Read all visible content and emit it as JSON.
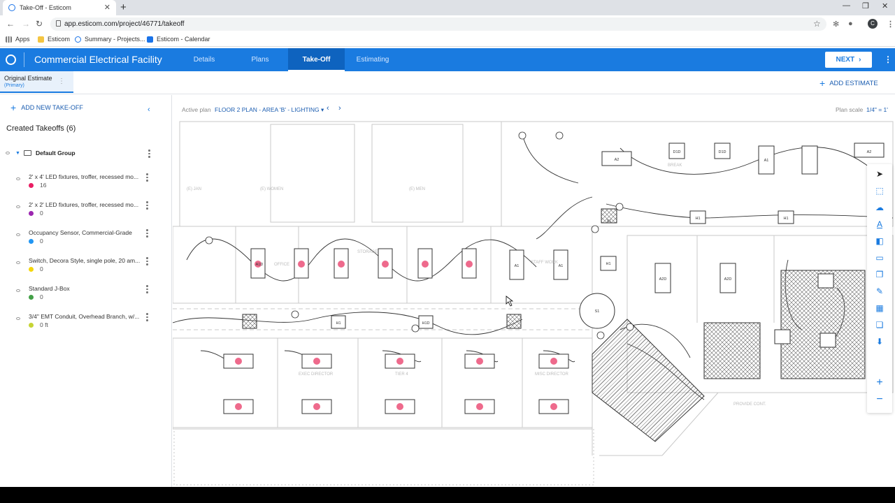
{
  "browser": {
    "tab_title": "Take-Off - Esticom",
    "url": "app.esticom.com/project/46771/takeoff",
    "avatar_initial": "C",
    "bookmarks": [
      "Apps",
      "Esticom",
      "Summary - Projects...",
      "Esticom - Calendar"
    ]
  },
  "app": {
    "project_title": "Commercial Electrical Facility",
    "tabs": [
      "Details",
      "Plans",
      "Take-Off",
      "Estimating"
    ],
    "active_tab": "Take-Off",
    "next_label": "NEXT",
    "accent_color": "#1a7be0"
  },
  "estimate": {
    "name": "Original Estimate",
    "sub": "(Primary)",
    "add_label": "ADD ESTIMATE"
  },
  "sidebar": {
    "add_label": "ADD NEW TAKE-OFF",
    "created_label": "Created Takeoffs (6)",
    "group_name": "Default Group",
    "items": [
      {
        "name": "2' x 4' LED fixtures, troffer, recessed mo...",
        "count": "16",
        "color": "#e91e63"
      },
      {
        "name": "2' x 2' LED fixtures, troffer, recessed mo...",
        "count": "0",
        "color": "#9c27b0"
      },
      {
        "name": "Occupancy Sensor, Commercial-Grade",
        "count": "0",
        "color": "#2196f3"
      },
      {
        "name": "Switch, Decora Style, single pole, 20 am...",
        "count": "0",
        "color": "#f5d60a"
      },
      {
        "name": "Standard J-Box",
        "count": "0",
        "color": "#43a047"
      },
      {
        "name": "3/4\" EMT Conduit, Overhead Branch, w/...",
        "count": "0 ft",
        "color": "#c6d434"
      }
    ]
  },
  "plan": {
    "active_label": "Active plan",
    "active_name": "FLOOR 2 PLAN - AREA 'B' - LIGHTING",
    "scale_label": "Plan scale",
    "scale_value": "1/4\" = 1'",
    "room_labels": [
      "(E) JAN",
      "(E) WOMEN",
      "(E) MEN",
      "OFFICE",
      "STORAGE",
      "STAFF WORK",
      "BREAK",
      "TIER 4",
      "EXEC DIRECTOR",
      "MISC DIRECTOR",
      "PROVIDE CONT.",
      "A1D",
      "A1",
      "A2",
      "A2D",
      "D1D",
      "H1",
      "H1D",
      "S1",
      "X1"
    ]
  },
  "tools": [
    "select-icon",
    "area-icon",
    "cloud-icon",
    "text-icon",
    "compare-icon",
    "ruler-icon",
    "copy-icon",
    "pen-icon",
    "grid-icon",
    "layers-icon",
    "download-icon",
    "zoom-in-icon",
    "zoom-out-icon"
  ]
}
